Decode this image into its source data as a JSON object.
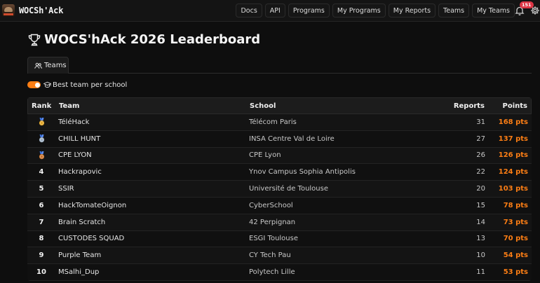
{
  "brand": {
    "name": "WOCSh'Ack"
  },
  "nav": {
    "links": [
      "Docs",
      "API",
      "Programs",
      "My Programs",
      "My Reports",
      "Teams",
      "My Teams"
    ],
    "notifications_count": "151"
  },
  "page": {
    "title": "WOCS'hAck 2026 Leaderboard"
  },
  "tabs": [
    {
      "label": "Teams",
      "icon": "people-icon"
    }
  ],
  "filter": {
    "label": "Best team per school",
    "enabled": true,
    "icon": "mortarboard-icon"
  },
  "table": {
    "headers": {
      "rank": "Rank",
      "team": "Team",
      "school": "School",
      "reports": "Reports",
      "points": "Points"
    },
    "rows": [
      {
        "rank": "1",
        "medal": "gold",
        "team": "TéléHack",
        "school": "Télécom Paris",
        "reports": "31",
        "points": "168 pts"
      },
      {
        "rank": "2",
        "medal": "silver",
        "team": "CHILL HUNT",
        "school": "INSA Centre Val de Loire",
        "reports": "27",
        "points": "137 pts"
      },
      {
        "rank": "3",
        "medal": "bronze",
        "team": "CPE LYON",
        "school": "CPE Lyon",
        "reports": "26",
        "points": "126 pts"
      },
      {
        "rank": "4",
        "medal": "",
        "team": "Hackrapovic",
        "school": "Ynov Campus Sophia Antipolis",
        "reports": "22",
        "points": "124 pts"
      },
      {
        "rank": "5",
        "medal": "",
        "team": "SSIR",
        "school": "Université de Toulouse",
        "reports": "20",
        "points": "103 pts"
      },
      {
        "rank": "6",
        "medal": "",
        "team": "HackTomateOignon",
        "school": "CyberSchool",
        "reports": "15",
        "points": "78 pts"
      },
      {
        "rank": "7",
        "medal": "",
        "team": "Brain Scratch",
        "school": "42 Perpignan",
        "reports": "14",
        "points": "73 pts"
      },
      {
        "rank": "8",
        "medal": "",
        "team": "CUSTODES SQUAD",
        "school": "ESGI Toulouse",
        "reports": "13",
        "points": "70 pts"
      },
      {
        "rank": "9",
        "medal": "",
        "team": "Purple Team",
        "school": "CY Tech Pau",
        "reports": "10",
        "points": "54 pts"
      },
      {
        "rank": "10",
        "medal": "",
        "team": "MSalhi_Dup",
        "school": "Polytech Lille",
        "reports": "11",
        "points": "53 pts"
      }
    ]
  },
  "colors": {
    "accent": "#fd7e14",
    "badge": "#dc3545",
    "gold": "#e0a528",
    "silver": "#9fb0c2",
    "bronze": "#c9742f",
    "ribbon": "#3b6fd6"
  }
}
